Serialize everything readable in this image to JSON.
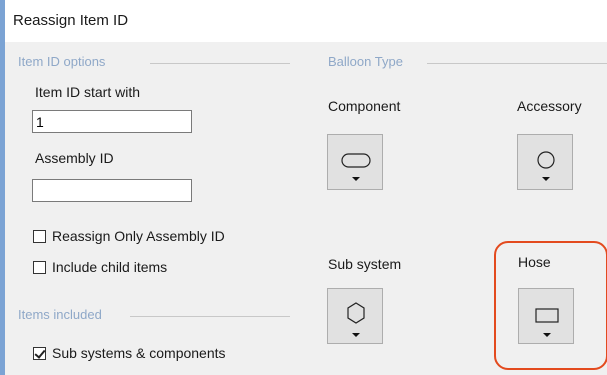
{
  "window": {
    "title": "Reassign Item ID"
  },
  "item_id_options": {
    "group_label": "Item ID options",
    "start_label": "Item ID start with",
    "start_value": "1",
    "assembly_label": "Assembly ID",
    "assembly_value": "",
    "reassign_only_assembly_label": "Reassign Only Assembly ID",
    "reassign_only_assembly_checked": false,
    "include_child_label": "Include child items",
    "include_child_checked": false
  },
  "items_included": {
    "group_label": "Items included",
    "sub_systems_label": "Sub systems & components",
    "sub_systems_checked": true
  },
  "balloon_type": {
    "group_label": "Balloon Type",
    "component": {
      "label": "Component",
      "icon": "rounded-rectangle-icon"
    },
    "accessory": {
      "label": "Accessory",
      "icon": "circle-icon"
    },
    "sub_system": {
      "label": "Sub system",
      "icon": "hexagon-icon"
    },
    "hose": {
      "label": "Hose",
      "icon": "rectangle-icon"
    }
  },
  "colors": {
    "highlight": "#e34a1e",
    "group_label": "#8fa8c8"
  }
}
